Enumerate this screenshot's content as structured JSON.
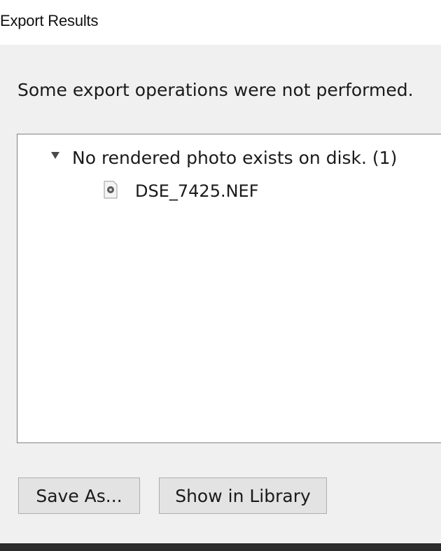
{
  "window": {
    "title": "Export Results"
  },
  "dialog": {
    "message": "Some export operations were not performed.",
    "tree": {
      "group": {
        "label": "No rendered photo exists on disk. (1)",
        "icon": "triangle-down-icon",
        "expanded": true,
        "items": [
          {
            "label": "DSE_7425.NEF",
            "icon": "raw-file-icon"
          }
        ]
      }
    },
    "buttons": {
      "save_as": "Save As...",
      "show_in_library": "Show in Library"
    }
  },
  "colors": {
    "dialog_background": "#f0f0f0",
    "tree_background": "#ffffff",
    "button_background": "#e3e3e3",
    "button_border": "#adadad",
    "text": "#1a1a1a",
    "bottom_strip": "#2b2b2b"
  }
}
